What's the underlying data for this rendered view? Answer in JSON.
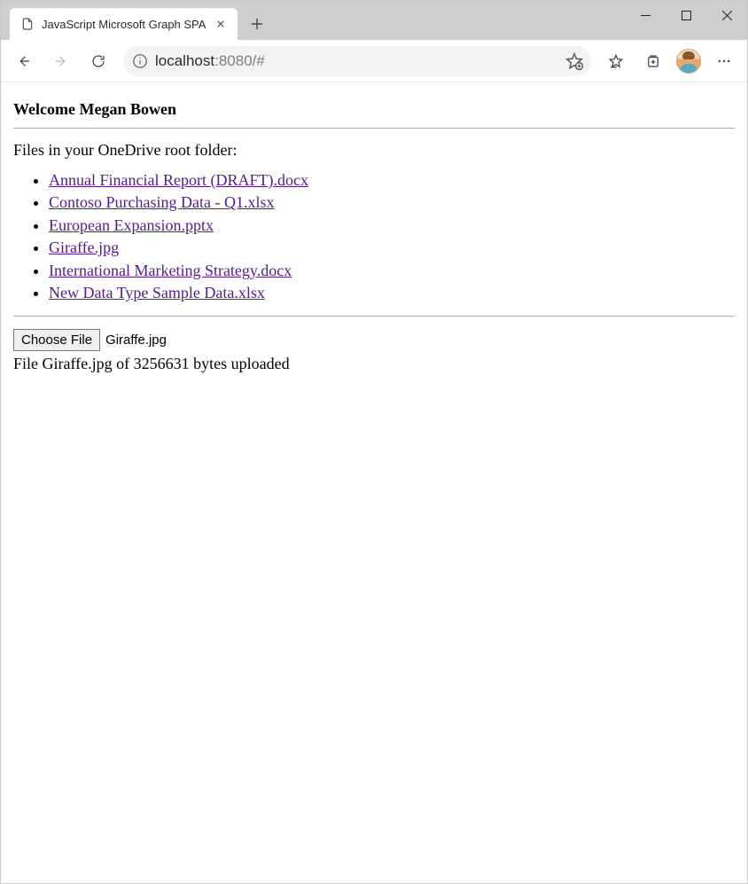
{
  "browser": {
    "tab_title": "JavaScript Microsoft Graph SPA",
    "url_host": "localhost",
    "url_port_path": ":8080/#"
  },
  "page": {
    "welcome_prefix": "Welcome ",
    "user_name": "Megan Bowen",
    "files_heading": "Files in your OneDrive root folder:",
    "files": [
      "Annual Financial Report (DRAFT).docx",
      "Contoso Purchasing Data - Q1.xlsx",
      "European Expansion.pptx",
      "Giraffe.jpg",
      "International Marketing Strategy.docx",
      "New Data Type Sample Data.xlsx"
    ],
    "choose_file_label": "Choose File",
    "chosen_file": "Giraffe.jpg",
    "upload_status": "File Giraffe.jpg of 3256631 bytes uploaded"
  }
}
